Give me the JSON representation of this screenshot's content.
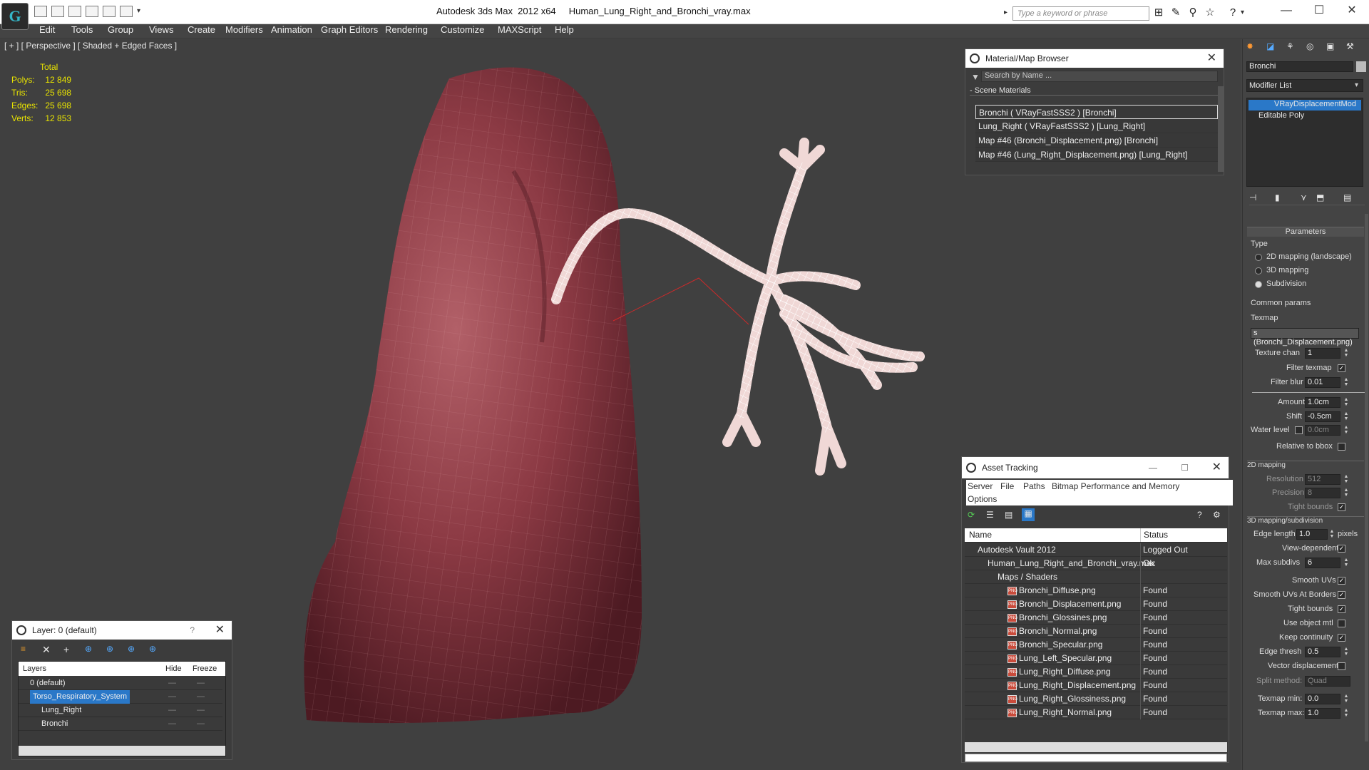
{
  "app": {
    "title": "Autodesk 3ds Max  2012 x64     Human_Lung_Right_and_Bronchi_vray.max",
    "search_placeholder": "Type a keyword or phrase",
    "logo_text": "G",
    "window_controls": [
      "—",
      "☐",
      "✕"
    ]
  },
  "menu": [
    "Edit",
    "Tools",
    "Group",
    "Views",
    "Create",
    "Modifiers",
    "Animation",
    "Graph Editors",
    "Rendering",
    "Customize",
    "MAXScript",
    "Help"
  ],
  "viewport": {
    "label": "[ + ] [ Perspective ] [ Shaded + Edged Faces ]",
    "stats_header": "Total",
    "stats": [
      {
        "label": "Polys:",
        "value": "12 849"
      },
      {
        "label": "Tris:",
        "value": "25 698"
      },
      {
        "label": "Edges:",
        "value": "25 698"
      },
      {
        "label": "Verts:",
        "value": "12 853"
      }
    ]
  },
  "material_browser": {
    "title": "Material/Map Browser",
    "search_placeholder": "Search by Name ...",
    "section": "Scene Materials",
    "items": [
      "Bronchi  ( VRayFastSSS2 )  [Bronchi]",
      "Lung_Right  ( VRayFastSSS2 )  [Lung_Right]",
      "Map #46 (Bronchi_Displacement.png)  [Bronchi]",
      "Map #46 (Lung_Right_Displacement.png)  [Lung_Right]"
    ]
  },
  "asset_tracking": {
    "title": "Asset Tracking",
    "menu": [
      "Server",
      "File",
      "Paths",
      "Bitmap Performance and Memory",
      "Options"
    ],
    "columns": [
      "Name",
      "Status"
    ],
    "rows": [
      {
        "name": "Autodesk Vault 2012",
        "status": "Logged Out",
        "indent": 0,
        "kind": "vault"
      },
      {
        "name": "Human_Lung_Right_and_Bronchi_vray.max",
        "status": "Ok",
        "indent": 1,
        "kind": "max"
      },
      {
        "name": "Maps / Shaders",
        "status": "",
        "indent": 2,
        "kind": "folder"
      },
      {
        "name": "Bronchi_Diffuse.png",
        "status": "Found",
        "indent": 3,
        "kind": "png"
      },
      {
        "name": "Bronchi_Displacement.png",
        "status": "Found",
        "indent": 3,
        "kind": "png"
      },
      {
        "name": "Bronchi_Glossines.png",
        "status": "Found",
        "indent": 3,
        "kind": "png"
      },
      {
        "name": "Bronchi_Normal.png",
        "status": "Found",
        "indent": 3,
        "kind": "png"
      },
      {
        "name": "Bronchi_Specular.png",
        "status": "Found",
        "indent": 3,
        "kind": "png"
      },
      {
        "name": "Lung_Left_Specular.png",
        "status": "Found",
        "indent": 3,
        "kind": "png"
      },
      {
        "name": "Lung_Right_Diffuse.png",
        "status": "Found",
        "indent": 3,
        "kind": "png"
      },
      {
        "name": "Lung_Right_Displacement.png",
        "status": "Found",
        "indent": 3,
        "kind": "png"
      },
      {
        "name": "Lung_Right_Glossiness.png",
        "status": "Found",
        "indent": 3,
        "kind": "png"
      },
      {
        "name": "Lung_Right_Normal.png",
        "status": "Found",
        "indent": 3,
        "kind": "png"
      }
    ]
  },
  "layer_panel": {
    "title": "Layer: 0 (default)",
    "help": "?",
    "columns": [
      "Layers",
      "Hide",
      "Freeze"
    ],
    "rows": [
      {
        "name": "0 (default)",
        "selected": false,
        "indent": 1
      },
      {
        "name": "Torso_Respiratory_System",
        "selected": true,
        "indent": 1
      },
      {
        "name": "Lung_Right",
        "selected": false,
        "indent": 2
      },
      {
        "name": "Bronchi",
        "selected": false,
        "indent": 2
      }
    ]
  },
  "command_panel": {
    "object_name": "Bronchi",
    "modifier_list": "Modifier List",
    "stack": [
      "VRayDisplacementMod",
      "Editable Poly"
    ],
    "rollout": "Parameters",
    "type_label": "Type",
    "type_options": [
      "2D mapping (landscape)",
      "3D mapping",
      "Subdivision"
    ],
    "common_params": "Common params",
    "texmap_label": "Texmap",
    "texmap_value": "s (Bronchi_Displacement.png)",
    "texture_chan_label": "Texture chan",
    "texture_chan": "1",
    "filter_texmap": "Filter texmap",
    "filter_blur_label": "Filter blur",
    "filter_blur": "0.01",
    "amount_label": "Amount",
    "amount": "1.0cm",
    "shift_label": "Shift",
    "shift": "-0.5cm",
    "water_level_label": "Water level",
    "water_level": "0.0cm",
    "relative_bbox": "Relative to bbox",
    "section_2d": "2D mapping",
    "resolution_label": "Resolution",
    "resolution": "512",
    "precision_label": "Precision",
    "precision": "8",
    "tight_bounds": "Tight bounds",
    "section_3d": "3D mapping/subdivision",
    "edge_length_label": "Edge length",
    "edge_length": "1.0",
    "pixels": "pixels",
    "view_dependent": "View-dependent",
    "max_subdivs_label": "Max subdivs",
    "max_subdivs": "6",
    "smooth_uvs": "Smooth UVs",
    "smooth_uvs_borders": "Smooth UVs At Borders",
    "tight_bounds2": "Tight bounds",
    "use_object_mtl": "Use object mtl",
    "keep_continuity": "Keep continuity",
    "edge_thresh_label": "Edge thresh",
    "edge_thresh": "0.5",
    "vector_disp": "Vector displacement",
    "split_method_label": "Split method:",
    "split_method": "Quad",
    "texmap_min_label": "Texmap min:",
    "texmap_min": "0.0",
    "texmap_max_label": "Texmap max:",
    "texmap_max": "1.0"
  },
  "colors": {
    "accent_blue": "#2a78c8",
    "stats_yellow": "#e9e400",
    "lung": "#8c3a44",
    "wire": "#ffffff"
  }
}
